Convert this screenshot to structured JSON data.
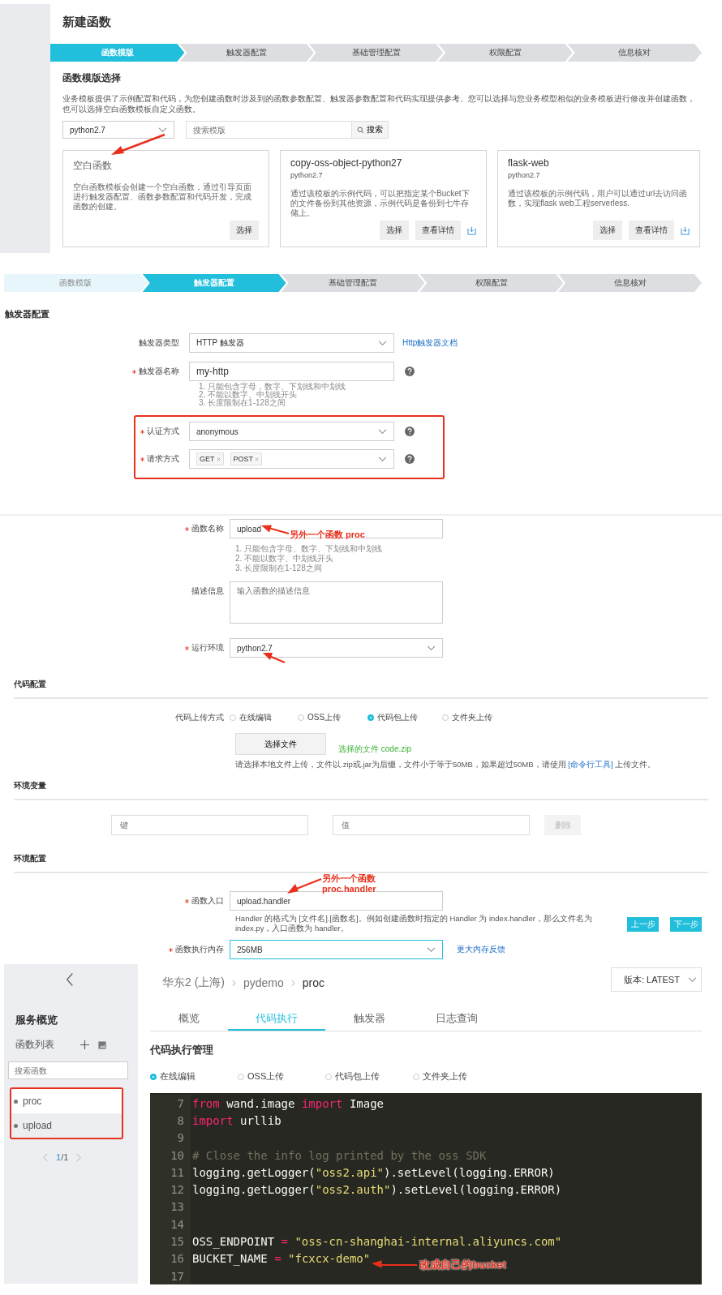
{
  "template_panel": {
    "title": "新建函数",
    "steps": [
      {
        "label": "函数模版",
        "selected": true,
        "done": false
      },
      {
        "label": "触发器配置",
        "selected": false,
        "done": false
      },
      {
        "label": "基础管理配置",
        "selected": false,
        "done": false
      },
      {
        "label": "权限配置",
        "selected": false,
        "done": false
      },
      {
        "label": "信息核对",
        "selected": false,
        "done": false
      }
    ],
    "section_title": "函数模版选择",
    "description": "业务模板提供了示例配置和代码，为您创建函数时涉及到的函数参数配置、触发器参数配置和代码实现提供参考。您可以选择与您业务模型相似的业务模板进行修改并创建函数，也可以选择空白函数模板自定义函数。",
    "runtime_select": {
      "value": "python2.7"
    },
    "search": {
      "placeholder": "搜索模版",
      "button": "搜索"
    },
    "cards": [
      {
        "kind": "blank",
        "title": "空白函数",
        "description": "空白函数模板会创建一个空白函数，通过引导页面进行触发器配置、函数参数配置和代码开发，完成函数的创建。",
        "buttons": [
          "选择"
        ],
        "download": false
      },
      {
        "kind": "template",
        "title": "copy-oss-object-python27",
        "subtitle": "python2.7",
        "description": "通过该模板的示例代码，可以把指定某个Bucket下的文件备份到其他资源，示例代码是备份到七牛存储上。",
        "buttons": [
          "选择",
          "查看详情"
        ],
        "download": true
      },
      {
        "kind": "template",
        "title": "flask-web",
        "subtitle": "python2.7",
        "description": "通过该模板的示例代码，用户可以通过url去访问函数，实现flask web工程serverless.",
        "buttons": [
          "选择",
          "查看详情"
        ],
        "download": true
      }
    ]
  },
  "trigger_panel": {
    "steps": [
      {
        "label": "函数模版",
        "selected": false,
        "done": true
      },
      {
        "label": "触发器配置",
        "selected": true,
        "done": false
      },
      {
        "label": "基础管理配置",
        "selected": false,
        "done": false
      },
      {
        "label": "权限配置",
        "selected": false,
        "done": false
      },
      {
        "label": "信息核对",
        "selected": false,
        "done": false
      }
    ],
    "section_title": "触发器配置",
    "fields": [
      {
        "kind": "select",
        "label": "触发器类型",
        "required": false,
        "value": "HTTP 触发器",
        "link": "Http触发器文档",
        "help": false
      },
      {
        "kind": "input",
        "label": "触发器名称",
        "required": true,
        "value": "my-http",
        "help": true,
        "hints": [
          "1. 只能包含字母，数字、下划线和中划线",
          "2. 不能以数字、中划线开头",
          "3. 长度限制在1-128之间"
        ]
      }
    ],
    "highlighted_group": {
      "highlighted": true,
      "fields": [
        {
          "kind": "select",
          "label": "认证方式",
          "required": true,
          "value": "anonymous",
          "help": true
        },
        {
          "kind": "tags",
          "label": "请求方式",
          "required": true,
          "tags": [
            "GET",
            "POST"
          ],
          "help": true
        }
      ]
    }
  },
  "function_panel": {
    "fields": [
      {
        "kind": "input",
        "label": "函数名称",
        "required": true,
        "value": "upload",
        "note": "另外一个函数 proc",
        "hints": [
          "1. 只能包含字母、数字、下划线和中划线",
          "2. 不能以数字、中划线开头",
          "3. 长度限制在1-128之间"
        ]
      },
      {
        "kind": "textarea",
        "label": "描述信息",
        "required": false,
        "placeholder": "输入函数的描述信息"
      },
      {
        "kind": "select",
        "label": "运行环境",
        "required": true,
        "value": "python2.7"
      }
    ],
    "code_config": {
      "title": "代码配置",
      "method_label": "代码上传方式",
      "methods": [
        {
          "label": "在线编辑",
          "selected": false
        },
        {
          "label": "OSS上传",
          "selected": false
        },
        {
          "label": "代码包上传",
          "selected": true
        },
        {
          "label": "文件夹上传",
          "selected": false
        }
      ],
      "file_button": "选择文件",
      "file_status": "选择的文件 code.zip",
      "hint_before": "请选择本地文件上传，文件以.zip或.jar为后缀，文件小于等于50MB，如果超过50MB，请使用 ",
      "hint_link": "[命令行工具]",
      "hint_after": " 上传文件。"
    },
    "env_vars": {
      "title": "环境变量",
      "key_placeholder": "键",
      "value_placeholder": "值",
      "delete_button": "删除",
      "delete_disabled": true
    },
    "env_config": {
      "title": "环境配置",
      "entry": {
        "label": "函数入口",
        "required": true,
        "value": "upload.handler",
        "note_lines": [
          "另外一个函数",
          "proc.handler"
        ],
        "hint": "Handler 的格式为 [文件名].[函数名]。例如创建函数时指定的 Handler 为 index.handler，那么文件名为 index.py，入口函数为 handler。"
      },
      "prev_button": "上一步",
      "next_button": "下一步",
      "memory": {
        "label": "函数执行内存",
        "required": true,
        "value": "256MB",
        "focused": true,
        "link": "更大内存反馈"
      }
    }
  },
  "console_panel": {
    "sidebar": {
      "service_overview": "服务概览",
      "function_list": "函数列表",
      "search_placeholder": "搜索函数",
      "highlighted": true,
      "functions": [
        {
          "name": "proc",
          "selected": true
        },
        {
          "name": "upload",
          "selected": false
        }
      ],
      "page_current": "1",
      "page_rest": "/1"
    },
    "breadcrumb": [
      "华东2 (上海)",
      "pydemo",
      "proc"
    ],
    "version": "版本: LATEST",
    "tabs": [
      {
        "label": "概览",
        "selected": false
      },
      {
        "label": "代码执行",
        "selected": true
      },
      {
        "label": "触发器",
        "selected": false
      },
      {
        "label": "日志查询",
        "selected": false
      }
    ],
    "section_title": "代码执行管理",
    "methods": [
      {
        "label": "在线编辑",
        "selected": true
      },
      {
        "label": "OSS上传",
        "selected": false
      },
      {
        "label": "代码包上传",
        "selected": false
      },
      {
        "label": "文件夹上传",
        "selected": false
      }
    ],
    "code": [
      {
        "line": "7",
        "tokens": [
          {
            "kind": "kw",
            "text": "from"
          },
          {
            "kind": "plain",
            "text": " wand.image "
          },
          {
            "kind": "kw",
            "text": "import"
          },
          {
            "kind": "plain",
            "text": " Image"
          }
        ]
      },
      {
        "line": "8",
        "tokens": [
          {
            "kind": "kw",
            "text": "import"
          },
          {
            "kind": "plain",
            "text": " urllib"
          }
        ]
      },
      {
        "line": "9"
      },
      {
        "line": "10",
        "tokens": [
          {
            "kind": "comment",
            "text": "# Close the info log printed by the oss SDK"
          }
        ]
      },
      {
        "line": "11",
        "tokens": [
          {
            "kind": "plain",
            "text": "logging.getLogger("
          },
          {
            "kind": "str",
            "text": "\"oss2.api\""
          },
          {
            "kind": "plain",
            "text": ").setLevel(logging.ERROR)"
          }
        ]
      },
      {
        "line": "12",
        "tokens": [
          {
            "kind": "plain",
            "text": "logging.getLogger("
          },
          {
            "kind": "str",
            "text": "\"oss2.auth\""
          },
          {
            "kind": "plain",
            "text": ").setLevel(logging.ERROR)"
          }
        ]
      },
      {
        "line": "13"
      },
      {
        "line": "14"
      },
      {
        "line": "15",
        "tokens": [
          {
            "kind": "plain",
            "text": "OSS_ENDPOINT "
          },
          {
            "kind": "op",
            "text": "="
          },
          {
            "kind": "str",
            "text": " \"oss-cn-shanghai-internal.aliyuncs.com\""
          }
        ]
      },
      {
        "line": "16",
        "tokens": [
          {
            "kind": "plain",
            "text": "BUCKET_NAME "
          },
          {
            "kind": "op",
            "text": "="
          },
          {
            "kind": "str",
            "text": " \"fcxcx-demo\""
          }
        ]
      },
      {
        "line": "17"
      }
    ],
    "note": "改成自己的bucket"
  }
}
